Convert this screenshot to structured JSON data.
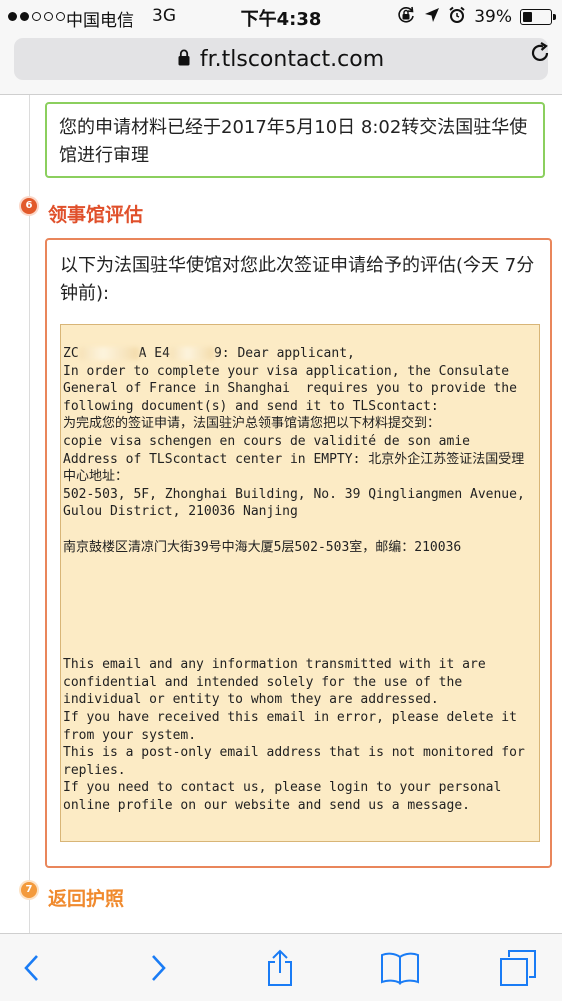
{
  "status_bar": {
    "carrier": "中国电信",
    "network": "3G",
    "time": "下午4:38",
    "battery": "39%",
    "battery_level": 0.39
  },
  "browser": {
    "url": "fr.tlscontact.com"
  },
  "page": {
    "forwarded_notice": "您的申请材料已经于2017年5月10日 8:02转交法国驻华使馆进行审理",
    "section6": {
      "number": "6",
      "title": "领事馆评估",
      "intro": "以下为法国驻华使馆对您此次签证申请给予的评估(今天 7分钟前):",
      "email": {
        "greeting_prefix": "ZC",
        "greeting_mid": "A E4",
        "greeting_suffix": "9: Dear applicant,",
        "body_lines": [
          "In order to complete your visa application, the Consulate General of France in Shanghai  requires you to provide the following document(s) and send it to TLScontact:",
          "为完成您的签证申请，法国驻沪总领事馆请您把以下材料提交到：",
          "copie visa schengen en cours de validité de son amie",
          "Address of TLScontact center in EMPTY: 北京外企江苏签证法国受理中心地址：",
          "502-503, 5F, Zhonghai Building, No. 39 Qingliangmen Avenue, Gulou District, 210036 Nanjing"
        ],
        "address_cn": "南京鼓楼区清凉门大街39号中海大厦5层502-503室，邮编：210036",
        "footer_lines": [
          "This email and any information transmitted with it are confidential and intended solely for the use of the individual or entity to whom they are addressed.",
          "If you have received this email in error, please delete it from your system.",
          "This is a post-only email address that is not monitored for replies.",
          "If you need to contact us, please login to your personal online profile on our website and send us a message."
        ]
      }
    },
    "section7": {
      "number": "7",
      "title": "返回护照"
    }
  },
  "colors": {
    "green_border": "#8bcf5e",
    "orange_border": "#e9865b",
    "section6_title": "#e0502b",
    "section7_title": "#f08a2e",
    "email_bg": "#fcebc5",
    "ios_blue": "#1a7cf5"
  },
  "icons": {
    "lock": "lock-icon",
    "reload": "reload-icon",
    "back": "chevron-left-icon",
    "forward": "chevron-right-icon",
    "share": "share-icon",
    "bookmarks": "book-icon",
    "tabs": "tabs-icon",
    "rotation_lock": "rotation-lock-icon",
    "location": "location-arrow-icon",
    "alarm": "alarm-icon"
  }
}
